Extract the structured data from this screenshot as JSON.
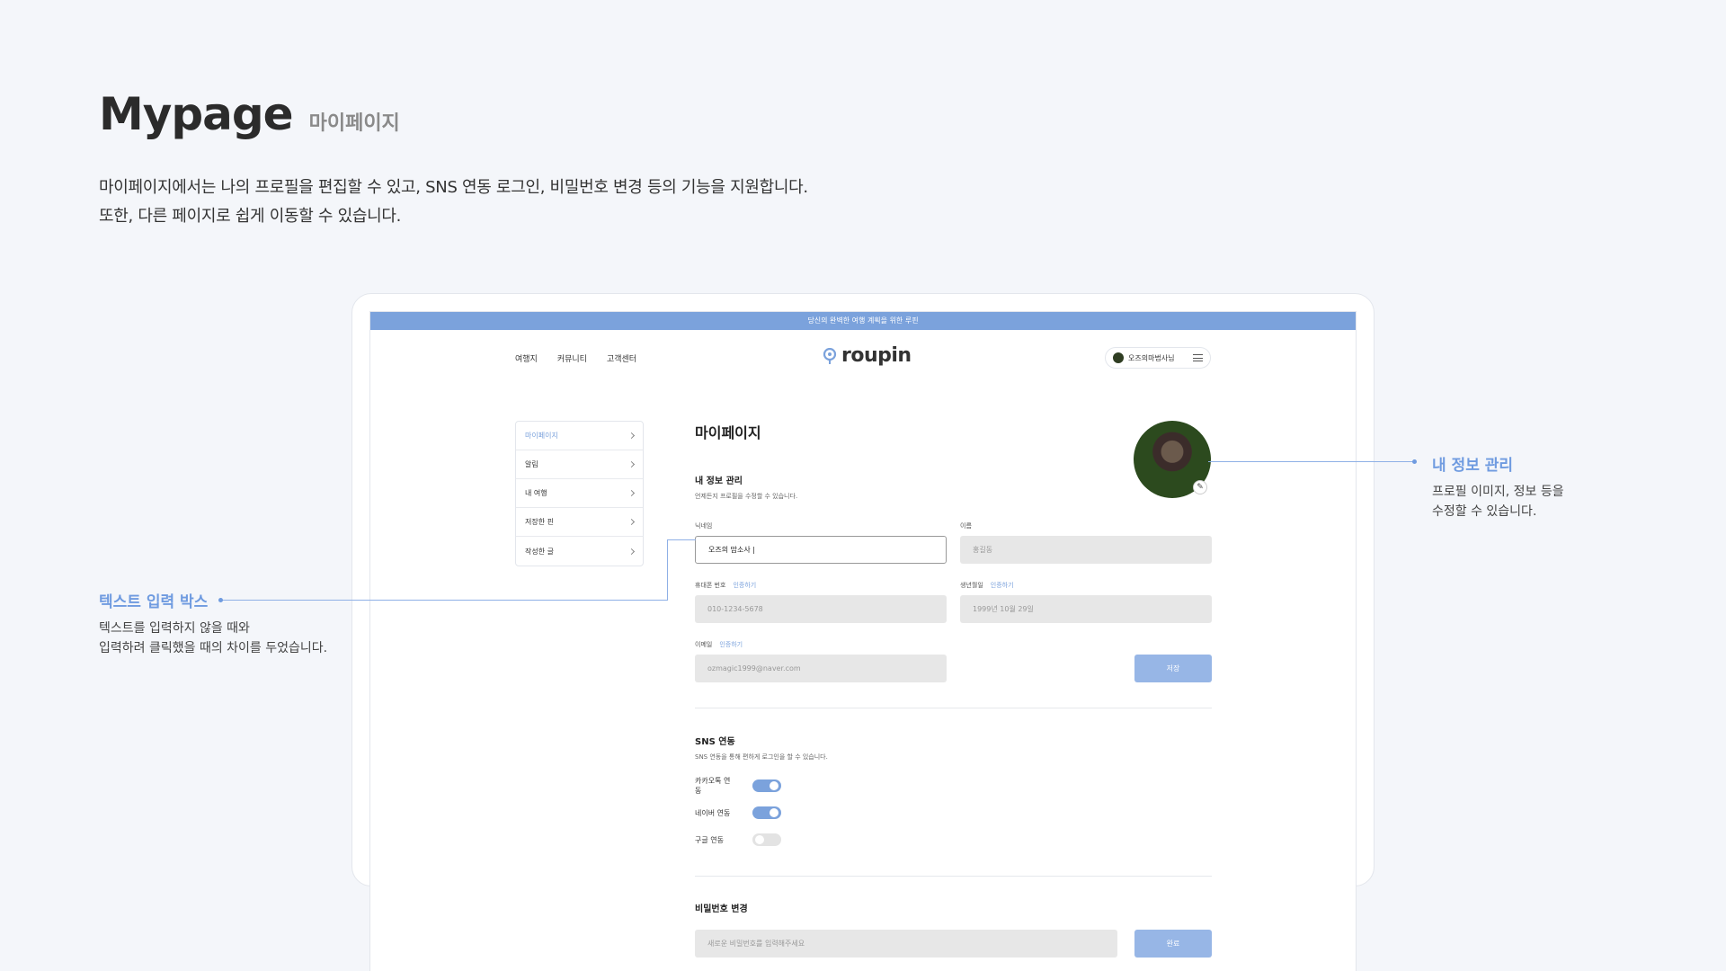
{
  "header": {
    "title": "Mypage",
    "subtitle": "마이페이지",
    "description_line1": "마이페이지에서는 나의 프로필을 편집할 수 있고, SNS 연동 로그인, 비밀번호 변경 등의 기능을 지원합니다.",
    "description_line2": "또한, 다른 페이지로 쉽게 이동할 수 있습니다."
  },
  "annotations": {
    "left": {
      "title": "텍스트 입력 박스",
      "line1": "텍스트를 입력하지 않을 때와",
      "line2": "입력하려 클릭했을 때의 차이를 두었습니다."
    },
    "right": {
      "title": "내 정보 관리",
      "line1": "프로필 이미지, 정보 등을",
      "line2": "수정할 수 있습니다."
    }
  },
  "app": {
    "banner": "당신의 완벽한 여행 계획을 위한 루핀",
    "nav": [
      "여행지",
      "커뮤니티",
      "고객센터"
    ],
    "logo": "roupin",
    "user_name": "오즈의마법사님",
    "sidebar": [
      "마이페이지",
      "알림",
      "내 여행",
      "저장한 핀",
      "작성한 글"
    ],
    "page_heading": "마이페이지",
    "info": {
      "title": "내 정보 관리",
      "desc": "언제든지 프로필을 수정할 수 있습니다.",
      "nickname_label": "닉네임",
      "nickname_value": "오즈의 맙소사 |",
      "name_label": "이름",
      "name_placeholder": "홍길동",
      "phone_label": "휴대폰 번호",
      "phone_link": "인증하기",
      "phone_value": "010-1234-5678",
      "birth_label": "생년월일",
      "birth_link": "인증하기",
      "birth_value": "1999년 10월 29일",
      "email_label": "이메일",
      "email_link": "인증하기",
      "email_value": "ozmagic1999@naver.com",
      "save_label": "저장"
    },
    "sns": {
      "title": "SNS 연동",
      "desc": "SNS 연동을 통해 편하게 로그인을 할 수 있습니다.",
      "items": [
        {
          "label": "카카오톡 연동",
          "on": true
        },
        {
          "label": "네이버 연동",
          "on": true
        },
        {
          "label": "구글 연동",
          "on": false
        }
      ]
    },
    "password": {
      "title": "비밀번호 변경",
      "placeholder": "새로운 비밀번호를 입력해주세요",
      "button_label": "완료"
    }
  },
  "colors": {
    "accent": "#7ba2dc",
    "button": "#97b6e6",
    "annotation": "#6f9be0"
  }
}
